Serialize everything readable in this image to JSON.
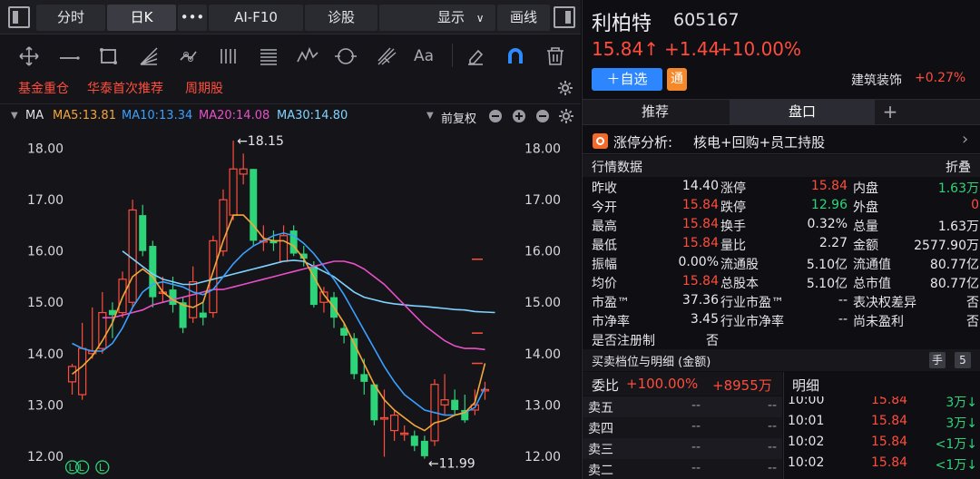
{
  "toolbar": {
    "tabs": [
      "分时",
      "日K",
      "•••",
      "AI-F10",
      "诊股",
      "显示",
      "画线"
    ],
    "tool_icons": [
      "move-icon",
      "line-icon",
      "rect-icon",
      "fan-icon",
      "chain-icon",
      "bars-icon",
      "lines-icon",
      "wave-icon",
      "cycle-icon",
      "fork-icon",
      "text-icon",
      "eraser-icon",
      "magnet-icon",
      "trash-icon"
    ],
    "text_tool": "Aa",
    "tags": [
      "基金重仓",
      "华泰首次推荐",
      "周期股"
    ],
    "ma": {
      "label": "MA",
      "ma5": "MA5:13.81",
      "ma10": "MA10:13.34",
      "ma20": "MA20:14.08",
      "ma30": "MA30:14.80",
      "adjust": "前复权"
    }
  },
  "chart_data": {
    "type": "candlestick",
    "y_ticks": [
      "18.00",
      "17.00",
      "16.00",
      "15.00",
      "14.00",
      "13.00",
      "12.00"
    ],
    "ylim": [
      11.75,
      18.4
    ],
    "high_label": "←18.15",
    "low_label": "←11.99",
    "candles": [
      {
        "o": 13.45,
        "c": 13.75,
        "h": 13.8,
        "l": 13.2
      },
      {
        "o": 13.2,
        "c": 14.1,
        "h": 14.6,
        "l": 13.1
      },
      {
        "o": 14.0,
        "c": 14.05,
        "h": 14.9,
        "l": 13.9
      },
      {
        "o": 14.1,
        "c": 14.8,
        "h": 15.2,
        "l": 14.0
      },
      {
        "o": 14.85,
        "c": 14.75,
        "h": 15.0,
        "l": 14.3
      },
      {
        "o": 14.8,
        "c": 15.45,
        "h": 15.6,
        "l": 14.7
      },
      {
        "o": 15.0,
        "c": 16.8,
        "h": 17.0,
        "l": 14.9
      },
      {
        "o": 16.7,
        "c": 16.0,
        "h": 16.9,
        "l": 15.9
      },
      {
        "o": 16.1,
        "c": 15.1,
        "h": 16.2,
        "l": 14.9
      },
      {
        "o": 15.2,
        "c": 15.2,
        "h": 15.5,
        "l": 15.0
      },
      {
        "o": 15.25,
        "c": 14.95,
        "h": 15.5,
        "l": 14.8
      },
      {
        "o": 15.0,
        "c": 14.5,
        "h": 15.1,
        "l": 14.4
      },
      {
        "o": 14.7,
        "c": 15.4,
        "h": 15.7,
        "l": 14.6
      },
      {
        "o": 14.8,
        "c": 14.7,
        "h": 15.0,
        "l": 14.55
      },
      {
        "o": 14.8,
        "c": 16.2,
        "h": 16.3,
        "l": 14.7
      },
      {
        "o": 16.0,
        "c": 17.0,
        "h": 17.2,
        "l": 15.9
      },
      {
        "o": 16.7,
        "c": 17.6,
        "h": 18.15,
        "l": 16.6
      },
      {
        "o": 17.5,
        "c": 17.6,
        "h": 17.9,
        "l": 17.3
      },
      {
        "o": 17.6,
        "c": 16.2,
        "h": 17.6,
        "l": 16.1
      },
      {
        "o": 16.2,
        "c": 16.2,
        "h": 16.5,
        "l": 16.0
      },
      {
        "o": 16.2,
        "c": 16.15,
        "h": 16.4,
        "l": 16.0
      },
      {
        "o": 15.8,
        "c": 16.3,
        "h": 16.5,
        "l": 15.8
      },
      {
        "o": 16.4,
        "c": 15.95,
        "h": 16.5,
        "l": 15.9
      },
      {
        "o": 15.95,
        "c": 15.85,
        "h": 16.1,
        "l": 15.7
      },
      {
        "o": 15.7,
        "c": 14.95,
        "h": 15.8,
        "l": 14.9
      },
      {
        "o": 15.0,
        "c": 15.2,
        "h": 15.3,
        "l": 14.8
      },
      {
        "o": 15.1,
        "c": 14.7,
        "h": 15.2,
        "l": 14.5
      },
      {
        "o": 14.5,
        "c": 14.35,
        "h": 14.6,
        "l": 14.2
      },
      {
        "o": 14.3,
        "c": 13.6,
        "h": 14.4,
        "l": 13.5
      },
      {
        "o": 13.6,
        "c": 13.45,
        "h": 13.9,
        "l": 13.2
      },
      {
        "o": 13.4,
        "c": 12.7,
        "h": 13.4,
        "l": 12.6
      },
      {
        "o": 12.75,
        "c": 12.75,
        "h": 13.3,
        "l": 11.99
      },
      {
        "o": 12.5,
        "c": 12.8,
        "h": 12.9,
        "l": 12.3
      },
      {
        "o": 12.45,
        "c": 12.45,
        "h": 12.6,
        "l": 12.3
      },
      {
        "o": 12.4,
        "c": 12.2,
        "h": 12.5,
        "l": 12.1
      },
      {
        "o": 12.3,
        "c": 12.0,
        "h": 12.4,
        "l": 11.95
      },
      {
        "o": 12.3,
        "c": 13.4,
        "h": 13.5,
        "l": 12.2
      },
      {
        "o": 13.0,
        "c": 13.1,
        "h": 13.6,
        "l": 12.8
      },
      {
        "o": 13.1,
        "c": 12.9,
        "h": 13.3,
        "l": 12.8
      },
      {
        "o": 12.9,
        "c": 12.7,
        "h": 13.2,
        "l": 12.65
      },
      {
        "o": 12.9,
        "c": 13.0,
        "h": 13.3,
        "l": 12.8
      },
      {
        "o": 13.3,
        "c": 13.3,
        "h": 13.45,
        "l": 13.1
      }
    ],
    "ma5": [
      13.6,
      13.75,
      13.95,
      14.25,
      14.6,
      15.1,
      15.5,
      15.65,
      15.5,
      15.2,
      15.05,
      14.95,
      14.9,
      15.0,
      15.6,
      16.2,
      16.7,
      16.7,
      16.5,
      16.25,
      16.2,
      16.2,
      16.1,
      15.85,
      15.5,
      15.15,
      14.9,
      14.6,
      14.2,
      13.8,
      13.4,
      13.1,
      12.9,
      12.75,
      12.6,
      12.5,
      12.65,
      12.7,
      12.8,
      12.85,
      13.05,
      13.81
    ],
    "ma10": [
      14.2,
      14.1,
      14.05,
      14.05,
      14.2,
      14.5,
      14.9,
      15.2,
      15.35,
      15.4,
      15.35,
      15.3,
      15.2,
      15.15,
      15.25,
      15.5,
      15.75,
      15.95,
      16.1,
      16.2,
      16.3,
      16.35,
      16.3,
      16.15,
      15.95,
      15.7,
      15.45,
      15.15,
      14.8,
      14.45,
      14.1,
      13.75,
      13.45,
      13.2,
      13.05,
      12.9,
      12.85,
      12.8,
      12.8,
      12.85,
      12.95,
      13.34
    ],
    "ma20": [
      14.7,
      14.7,
      14.75,
      14.8,
      14.85,
      14.95,
      15.0,
      15.05,
      15.1,
      15.15,
      15.2,
      15.25,
      15.25,
      15.3,
      15.35,
      15.4,
      15.45,
      15.5,
      15.55,
      15.6,
      15.65,
      15.7,
      15.75,
      15.8,
      15.8,
      15.75,
      15.65,
      15.5,
      15.35,
      15.15,
      14.95,
      14.75,
      14.55,
      14.4,
      14.25,
      14.15,
      14.1,
      14.1,
      14.08
    ],
    "ma20_offset": 3,
    "ma30": [
      16.0,
      15.85,
      15.7,
      15.55,
      15.45,
      15.4,
      15.35,
      15.35,
      15.4,
      15.45,
      15.5,
      15.55,
      15.6,
      15.65,
      15.7,
      15.75,
      15.8,
      15.82,
      15.8,
      15.7,
      15.6,
      15.5,
      15.35,
      15.2,
      15.1,
      15.05,
      15.0,
      14.97,
      14.95,
      14.93,
      14.92,
      14.9,
      14.88,
      14.86,
      14.85,
      14.82,
      14.81,
      14.8
    ],
    "ma30_offset": 5,
    "markers": [
      "L",
      "L",
      "L"
    ]
  },
  "stock": {
    "name": "利柏特",
    "code": "605167",
    "price": "15.84↑",
    "change": "+1.44",
    "pct": "+10.00%",
    "add_label": "＋自选",
    "tong": "通",
    "sector": "建筑装饰",
    "sector_pct": "+0.27%"
  },
  "subtabs": [
    "推荐",
    "盘口",
    "+"
  ],
  "analysis": {
    "label": "涨停分析:",
    "text": "核电+回购+员工持股",
    "arrow": "›"
  },
  "quote": {
    "title": "行情数据",
    "collapse": "折叠",
    "rows": [
      [
        [
          "昨收",
          "14.40",
          "w"
        ],
        [
          "涨停",
          "15.84",
          "r"
        ],
        [
          "内盘",
          "1.63万",
          "g"
        ]
      ],
      [
        [
          "今开",
          "15.84",
          "r"
        ],
        [
          "跌停",
          "12.96",
          "g"
        ],
        [
          "外盘",
          "0",
          "r"
        ]
      ],
      [
        [
          "最高",
          "15.84",
          "r"
        ],
        [
          "换手",
          "0.32%",
          "w"
        ],
        [
          "总量",
          "1.63万",
          "w"
        ]
      ],
      [
        [
          "最低",
          "15.84",
          "r"
        ],
        [
          "量比",
          "2.27",
          "w"
        ],
        [
          "金额",
          "2577.90万",
          "w"
        ]
      ],
      [
        [
          "振幅",
          "0.00%",
          "w"
        ],
        [
          "流通股",
          "5.10亿",
          "w"
        ],
        [
          "流通值",
          "80.77亿",
          "w"
        ]
      ],
      [
        [
          "均价",
          "15.84",
          "r"
        ],
        [
          "总股本",
          "5.10亿",
          "w"
        ],
        [
          "总市值",
          "80.77亿",
          "w"
        ]
      ],
      [
        [
          "市盈™",
          "37.36",
          "w"
        ],
        [
          "行业市盈™",
          "--",
          "w"
        ],
        [
          "表决权差异",
          "否",
          "w"
        ]
      ],
      [
        [
          "市净率",
          "3.45",
          "w"
        ],
        [
          "行业市净率",
          "--",
          "w"
        ],
        [
          "尚未盈利",
          "否",
          "w"
        ]
      ],
      [
        [
          "是否注册制",
          "否",
          "w"
        ],
        [
          "",
          "",
          "w"
        ],
        [
          "",
          "",
          "w"
        ]
      ]
    ]
  },
  "orderbook": {
    "title": "买卖档位与明细 (金额)",
    "hand": "手",
    "count": "5",
    "weibi_label": "委比",
    "weibi_pct": "+100.00%",
    "weibi_amt": "+8955万",
    "detail_label": "明细",
    "asks": [
      {
        "label": "卖五",
        "price": "--",
        "vol": "--"
      },
      {
        "label": "卖四",
        "price": "--",
        "vol": "--"
      },
      {
        "label": "卖三",
        "price": "--",
        "vol": "--"
      },
      {
        "label": "卖二",
        "price": "--",
        "vol": "--"
      }
    ],
    "ticks": [
      {
        "time": "10:00",
        "price": "15.84",
        "vol": "3万↓"
      },
      {
        "time": "10:01",
        "price": "15.84",
        "vol": "3万↓"
      },
      {
        "time": "10:02",
        "price": "15.84",
        "vol": "<1万↓"
      },
      {
        "time": "10:02",
        "price": "15.84",
        "vol": "<1万↓"
      }
    ]
  }
}
